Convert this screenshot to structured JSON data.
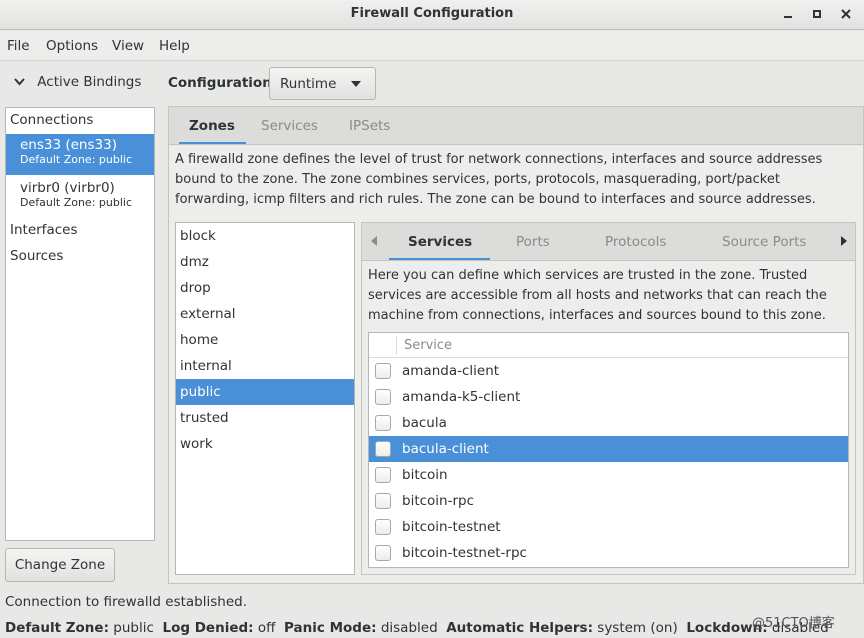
{
  "window": {
    "title": "Firewall Configuration"
  },
  "menubar": [
    "File",
    "Options",
    "View",
    "Help"
  ],
  "sidebar": {
    "header": "Active Bindings",
    "sections": {
      "connections": "Connections",
      "interfaces": "Interfaces",
      "sources": "Sources"
    },
    "connections": [
      {
        "name": "ens33 (ens33)",
        "zone": "Default Zone: public",
        "selected": true
      },
      {
        "name": "virbr0 (virbr0)",
        "zone": "Default Zone: public",
        "selected": false
      }
    ],
    "change_zone": "Change Zone"
  },
  "config": {
    "label": "Configuration:",
    "value": "Runtime"
  },
  "main_tabs": [
    "Zones",
    "Services",
    "IPSets"
  ],
  "zone_description": "A firewalld zone defines the level of trust for network connections, interfaces and source addresses bound to the zone. The zone combines services, ports, protocols, masquerading, port/packet forwarding, icmp filters and rich rules. The zone can be bound to interfaces and source addresses.",
  "zones": [
    "block",
    "dmz",
    "drop",
    "external",
    "home",
    "internal",
    "public",
    "trusted",
    "work"
  ],
  "selected_zone": "public",
  "sub_tabs": [
    "Services",
    "Ports",
    "Protocols",
    "Source Ports"
  ],
  "services_description": "Here you can define which services are trusted in the zone. Trusted services are accessible from all hosts and networks that can reach the machine from connections, interfaces and sources bound to this zone.",
  "services_table": {
    "header": "Service",
    "rows": [
      {
        "name": "amanda-client",
        "checked": false
      },
      {
        "name": "amanda-k5-client",
        "checked": false
      },
      {
        "name": "bacula",
        "checked": false
      },
      {
        "name": "bacula-client",
        "checked": false,
        "selected": true
      },
      {
        "name": "bitcoin",
        "checked": false
      },
      {
        "name": "bitcoin-rpc",
        "checked": false
      },
      {
        "name": "bitcoin-testnet",
        "checked": false
      },
      {
        "name": "bitcoin-testnet-rpc",
        "checked": false
      }
    ]
  },
  "status": {
    "message": "Connection to firewalld established.",
    "default_zone_label": "Default Zone:",
    "default_zone": "public",
    "log_denied_label": "Log Denied:",
    "log_denied": "off",
    "panic_mode_label": "Panic Mode:",
    "panic_mode": "disabled",
    "auto_helpers_label": "Automatic Helpers:",
    "auto_helpers": "system (on)",
    "lockdown_label": "Lockdown:",
    "lockdown": "disabled"
  },
  "watermark": "@51CTO博客",
  "colors": {
    "selection": "#4a90d9",
    "window_bg": "#e8e8e7"
  }
}
